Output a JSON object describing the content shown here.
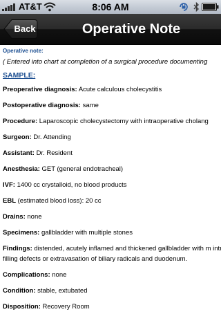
{
  "statusbar": {
    "carrier": "AT&T",
    "time": "8:06 AM"
  },
  "navbar": {
    "back_label": "Back",
    "title": "Operative Note"
  },
  "content": {
    "note_label": "Operative note:",
    "intro": "( Entered into chart at completion of a surgical procedure documenting",
    "sample_link": "SAMPLE:",
    "fields": [
      {
        "label": "Preoperative diagnosis:",
        "value": "Acute calculous cholecystitis"
      },
      {
        "label": "Postoperative diagnosis:",
        "value": "same"
      },
      {
        "label": "Procedure:",
        "value": "Laparoscopic cholecystectomy with intraoperative cholang"
      },
      {
        "label": "Surgeon:",
        "value": "Dr. Attending"
      },
      {
        "label": "Assistant:",
        "value": "Dr. Resident"
      },
      {
        "label": "Anesthesia:",
        "value": "GET (general endotracheal)"
      },
      {
        "label": "IVF:",
        "value": "1400 cc crystalloid, no blood products"
      },
      {
        "label": "EBL",
        "value": "(estimated blood loss): 20 cc"
      },
      {
        "label": "Drains:",
        "value": "none"
      },
      {
        "label": "Specimens:",
        "value": "gallbladder with multiple stones"
      },
      {
        "label": "Findings:",
        "value": "distended, acutely inflamed and thickened gallbladder with m intraoperative cholangiogram without filling defects or extravasation of biliary radicals and duodenum."
      },
      {
        "label": "Complications:",
        "value": "none"
      },
      {
        "label": "Condition:",
        "value": "stable, extubated"
      },
      {
        "label": "Disposition:",
        "value": "Recovery Room"
      }
    ]
  },
  "icons": {
    "signal": "signal-bars-icon",
    "wifi": "wifi-icon",
    "lock": "rotation-lock-icon",
    "bluetooth": "bluetooth-icon",
    "battery": "battery-icon"
  },
  "colors": {
    "accent_blue": "#1d4f91",
    "navbar": "#1a1a1a"
  }
}
